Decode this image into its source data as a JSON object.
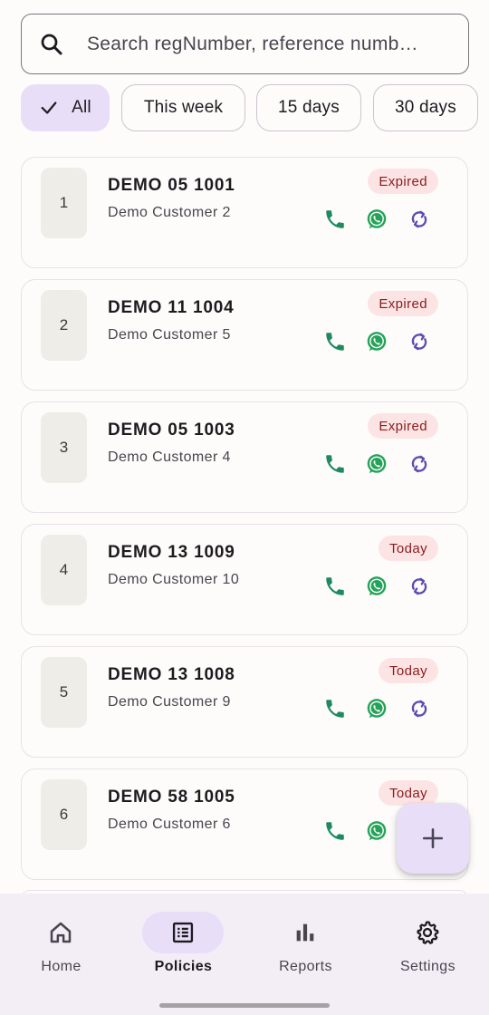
{
  "search": {
    "placeholder": "Search regNumber, reference numb…",
    "icon": "search-icon"
  },
  "filters": [
    {
      "label": "All",
      "selected": true
    },
    {
      "label": "This week",
      "selected": false
    },
    {
      "label": "15 days",
      "selected": false
    },
    {
      "label": "30 days",
      "selected": false
    }
  ],
  "policies": [
    {
      "index": "1",
      "reg": "DEMO 05 1001",
      "customer": "Demo Customer 2",
      "status": "Expired"
    },
    {
      "index": "2",
      "reg": "DEMO 11 1004",
      "customer": "Demo Customer 5",
      "status": "Expired"
    },
    {
      "index": "3",
      "reg": "DEMO 05 1003",
      "customer": "Demo Customer 4",
      "status": "Expired"
    },
    {
      "index": "4",
      "reg": "DEMO 13 1009",
      "customer": "Demo Customer 10",
      "status": "Today"
    },
    {
      "index": "5",
      "reg": "DEMO 13 1008",
      "customer": "Demo Customer 9",
      "status": "Today"
    },
    {
      "index": "6",
      "reg": "DEMO 58 1005",
      "customer": "Demo Customer 6",
      "status": "Today"
    }
  ],
  "nav": {
    "home": "Home",
    "policies": "Policies",
    "reports": "Reports",
    "settings": "Settings",
    "active": "policies"
  },
  "colors": {
    "accent": "#e8def8",
    "phone": "#1e8a5e",
    "whatsapp": "#25a35a",
    "renew": "#5b4bb3",
    "badge_bg": "#fce4e4",
    "badge_text": "#8a1c1c"
  }
}
